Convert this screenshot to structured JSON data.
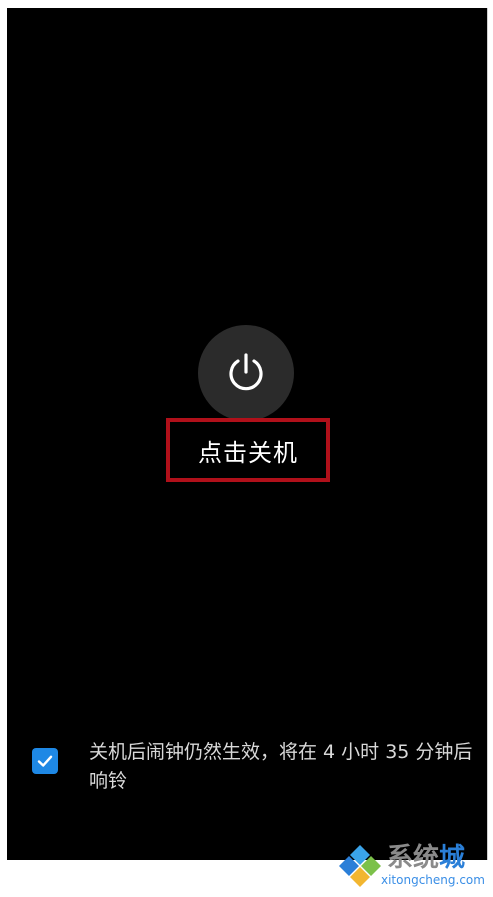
{
  "shutdown": {
    "label": "点击关机",
    "icon": "power-icon"
  },
  "alarm_notice": {
    "checked": true,
    "text": "关机后闹钟仍然生效，将在 4 小时 35 分钟后响铃"
  },
  "watermark": {
    "name_part1": "系统",
    "name_part2": "城",
    "url": "xitongcheng.com"
  },
  "colors": {
    "screen_background": "#000000",
    "power_button": "#2b2b2b",
    "highlight_border": "#b0101a",
    "checkbox": "#1e88e5"
  }
}
